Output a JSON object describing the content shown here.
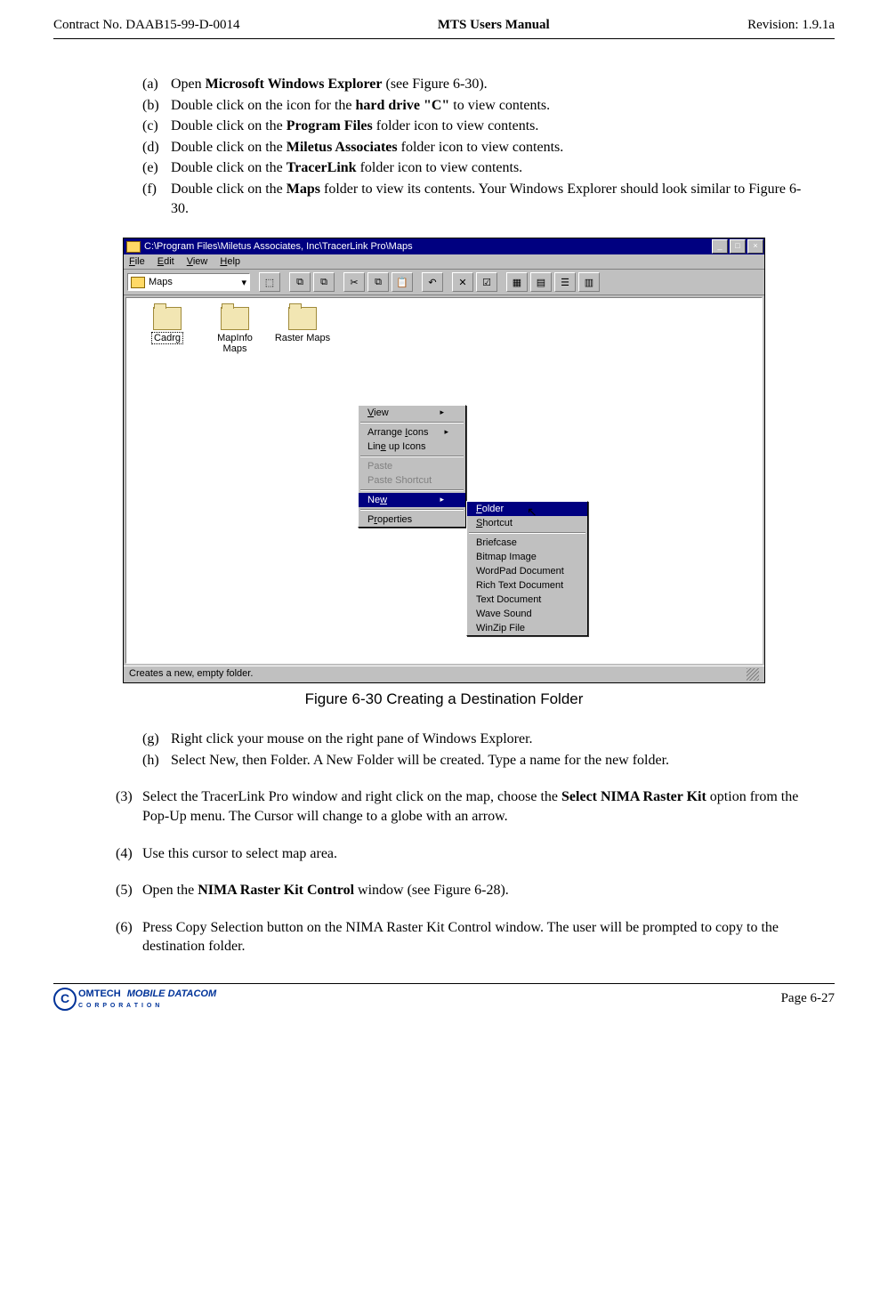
{
  "header": {
    "left": "Contract No. DAAB15-99-D-0014",
    "center": "MTS Users Manual",
    "right": "Revision:  1.9.1a"
  },
  "steps_a_f": [
    {
      "label": "(a)",
      "pre": "Open ",
      "bold": "Microsoft Windows Explorer",
      "post": " (see Figure 6-30)."
    },
    {
      "label": "(b)",
      "pre": "Double click on the icon for the ",
      "bold": "hard drive \"C\"",
      "post": " to view contents."
    },
    {
      "label": "(c)",
      "pre": "Double click on the ",
      "bold": "Program Files",
      "post": " folder icon to view contents."
    },
    {
      "label": "(d)",
      "pre": "Double click on the ",
      "bold": "Miletus Associates",
      "post": " folder icon to view contents."
    },
    {
      "label": "(e)",
      "pre": "Double click on the ",
      "bold": "TracerLink",
      "post": " folder icon to view contents."
    },
    {
      "label": "(f)",
      "pre": "Double click on the ",
      "bold": "Maps",
      "post": " folder to view its contents.  Your Windows Explorer should look similar to Figure 6-30."
    }
  ],
  "win": {
    "title": "C:\\Program Files\\Miletus Associates, Inc\\TracerLink Pro\\Maps",
    "menu": {
      "file": "File",
      "edit": "Edit",
      "view": "View",
      "help": "Help"
    },
    "address_label": "Maps",
    "folders": [
      {
        "name": "Cadrg",
        "selected": true
      },
      {
        "name": "MapInfo Maps",
        "selected": false
      },
      {
        "name": "Raster Maps",
        "selected": false
      }
    ],
    "ctx1": {
      "view": "View",
      "arrange": "Arrange Icons",
      "lineup": "Line up Icons",
      "paste": "Paste",
      "paste_shortcut": "Paste Shortcut",
      "new": "New",
      "properties": "Properties"
    },
    "ctx2": {
      "folder": "Folder",
      "shortcut": "Shortcut",
      "briefcase": "Briefcase",
      "bitmap": "Bitmap Image",
      "wordpad": "WordPad Document",
      "rtf": "Rich Text Document",
      "txt": "Text Document",
      "wave": "Wave Sound",
      "winzip": "WinZip File"
    },
    "status": "Creates a new, empty folder."
  },
  "figure_caption": "Figure 6-30   Creating a Destination Folder",
  "steps_g_h": [
    {
      "label": "(g)",
      "text": "Right click your mouse on the right pane of Windows Explorer."
    },
    {
      "label": "(h)",
      "text": "Select New, then Folder. A New Folder will be created. Type a name for the new folder."
    }
  ],
  "steps_3_6": [
    {
      "label": "(3)",
      "parts": [
        {
          "t": "Select the TracerLink Pro window and right click on the map, choose the "
        },
        {
          "t": "Select NIMA Raster Kit",
          "b": true
        },
        {
          "t": " option from the Pop-Up menu. The Cursor will change to a globe with an arrow."
        }
      ]
    },
    {
      "label": "(4)",
      "parts": [
        {
          "t": "Use this cursor to select map area."
        }
      ]
    },
    {
      "label": "(5)",
      "parts": [
        {
          "t": "Open the "
        },
        {
          "t": "NIMA Raster Kit Control",
          "b": true
        },
        {
          "t": " window (see Figure 6-28)."
        }
      ]
    },
    {
      "label": "(6)",
      "parts": [
        {
          "t": "Press Copy Selection button on the NIMA Raster Kit Control window. The user will be prompted to copy to the destination folder."
        }
      ]
    }
  ],
  "footer": {
    "logo1": "OMTECH",
    "logo2": "MOBILE DATACOM",
    "logo3": "C  O  R  P  O  R  A  T  I  O  N",
    "page": "Page 6-27"
  }
}
